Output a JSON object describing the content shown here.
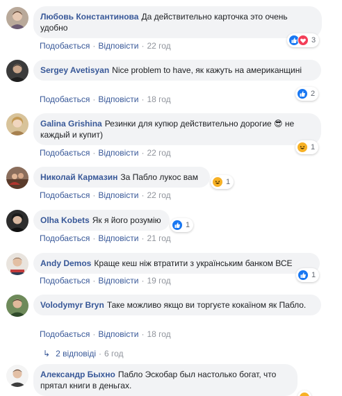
{
  "comments": [
    {
      "author": "Любовь Константинова",
      "text": "Да действительно карточка это очень удобно",
      "like": "Подобається",
      "reply": "Відповісти",
      "time": "22 год",
      "reactions": [
        "like",
        "love"
      ],
      "count": "3"
    },
    {
      "author": "Sergey Avetisyan",
      "text": "Nice problem to have, як кажуть на американщині",
      "like": "Подобається",
      "reply": "Відповісти",
      "time": "18 год",
      "reactions": [
        "like"
      ],
      "count": "2"
    },
    {
      "author": "Galina Grishina",
      "text": "Резинки для купюр действительно дорогие 😎 не каждый и купит)",
      "like": "Подобається",
      "reply": "Відповісти",
      "time": "22 год",
      "reactions": [
        "haha"
      ],
      "count": "1"
    },
    {
      "author": "Николай Кармазин",
      "text": "За Пабло лукос вам",
      "like": "Подобається",
      "reply": "Відповісти",
      "time": "22 год",
      "reactions": [
        "haha"
      ],
      "count": "1"
    },
    {
      "author": "Olha Kobets",
      "text": "Як я його розумію",
      "like": "Подобається",
      "reply": "Відповісти",
      "time": "21 год",
      "reactions": [
        "like"
      ],
      "count": "1"
    },
    {
      "author": "Andy Demos",
      "text": "Краще кеш ніж втратити з українським банком ВСЕ",
      "like": "Подобається",
      "reply": "Відповісти",
      "time": "19 год",
      "reactions": [
        "like"
      ],
      "count": "1"
    },
    {
      "author": "Volodymyr Bryn",
      "text": "Таке можливо якщо ви торгуєте кокаїном як Пабло.",
      "like": "Подобається",
      "reply": "Відповісти",
      "time": "18 год",
      "reactions": [],
      "count": ""
    },
    {
      "author": "Александр Быхно",
      "text": "Пабло Эскобар был настолько богат, что прятал книги в деньгах.",
      "like": "",
      "reply": "",
      "time": "",
      "reactions": [
        "haha"
      ],
      "count": ""
    }
  ],
  "replies_link": {
    "label": "2 відповіді",
    "time": "6 год"
  },
  "colors": {
    "link": "#385898",
    "bubble": "#f2f3f5",
    "meta": "#90949c",
    "like": "#1877f2",
    "love": "#f33e58",
    "haha": "#f7b125"
  }
}
